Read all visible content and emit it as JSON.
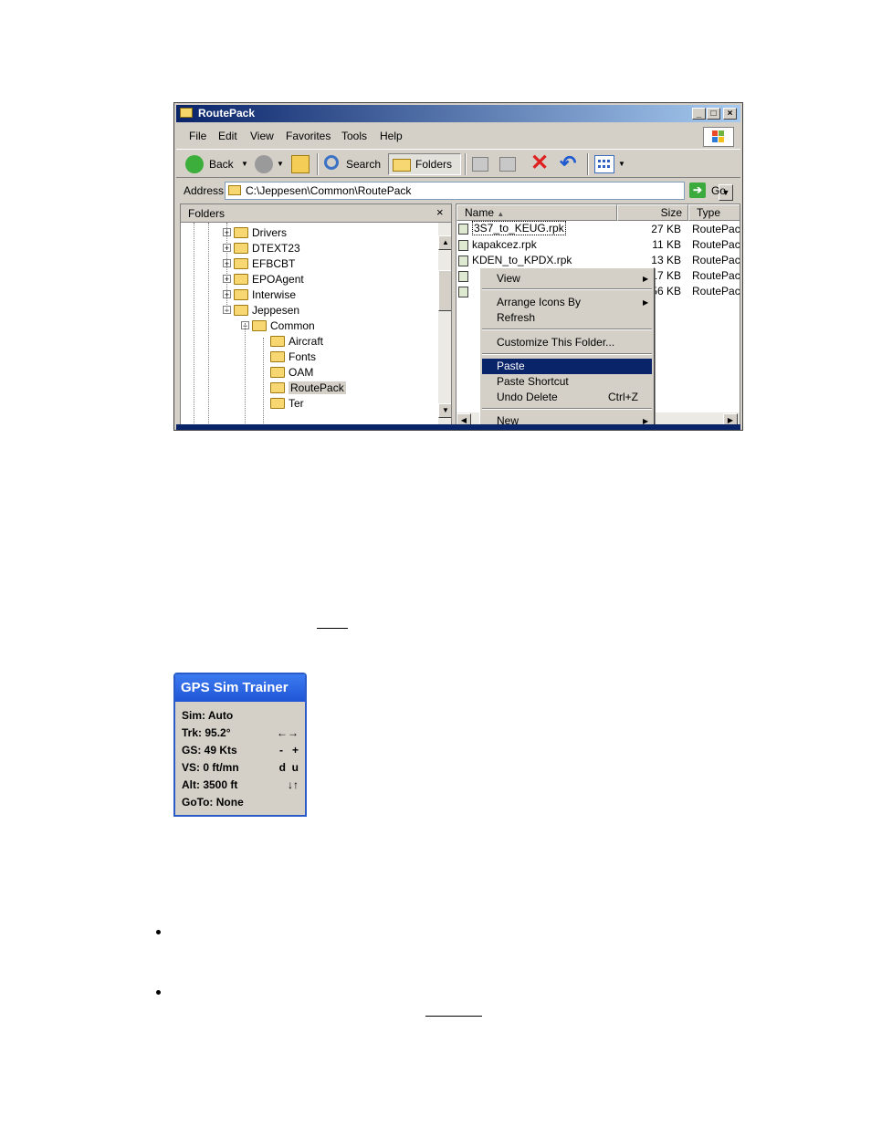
{
  "window": {
    "title": "RoutePack",
    "caption_buttons": [
      "_",
      "□",
      "×"
    ],
    "menu": [
      "File",
      "Edit",
      "View",
      "Favorites",
      "Tools",
      "Help"
    ],
    "toolbar": {
      "back": "Back",
      "search": "Search",
      "folders": "Folders"
    },
    "address": {
      "label": "Address",
      "value": "C:\\Jeppesen\\Common\\RoutePack",
      "go": "Go"
    },
    "folders_pane": {
      "title": "Folders",
      "close": "×",
      "items": [
        "Drivers",
        "DTEXT23",
        "EFBCBT",
        "EPOAgent",
        "Interwise",
        "Jeppesen",
        "Common",
        "Aircraft",
        "Fonts",
        "OAM",
        "RoutePack",
        "Ter"
      ]
    },
    "file_pane": {
      "columns": [
        "Name",
        "Size",
        "Type"
      ],
      "rows": [
        {
          "name": "3S7_to_KEUG.rpk",
          "size": "27 KB",
          "type": "RoutePac"
        },
        {
          "name": "kapakcez.rpk",
          "size": "11 KB",
          "type": "RoutePac"
        },
        {
          "name": "KDEN_to_KPDX.rpk",
          "size": "13 KB",
          "type": "RoutePac"
        },
        {
          "name": "",
          "size": "17 KB",
          "type": "RoutePac"
        },
        {
          "name": "",
          "size": "56 KB",
          "type": "RoutePac"
        }
      ]
    },
    "context_menu": [
      {
        "label": "View",
        "submenu": true
      },
      {
        "label": "Arrange Icons By",
        "submenu": true
      },
      {
        "label": "Refresh"
      },
      {
        "label": "Customize This Folder..."
      },
      {
        "label": "Paste",
        "highlighted": true
      },
      {
        "label": "Paste Shortcut"
      },
      {
        "label": "Undo Delete",
        "shortcut": "Ctrl+Z"
      },
      {
        "label": "New",
        "submenu": true
      }
    ]
  },
  "gps": {
    "title": "GPS Sim Trainer",
    "rows": [
      {
        "label": "Sim: Auto",
        "ctl": ""
      },
      {
        "label": "Trk: 95.2°",
        "ctl": "←→"
      },
      {
        "label": "GS: 49 Kts",
        "ctl": "-   +"
      },
      {
        "label": "VS: 0 ft/mn",
        "ctl": "d  u"
      },
      {
        "label": "Alt: 3500 ft",
        "ctl": "↓↑"
      },
      {
        "label": "GoTo: None",
        "ctl": ""
      }
    ]
  }
}
